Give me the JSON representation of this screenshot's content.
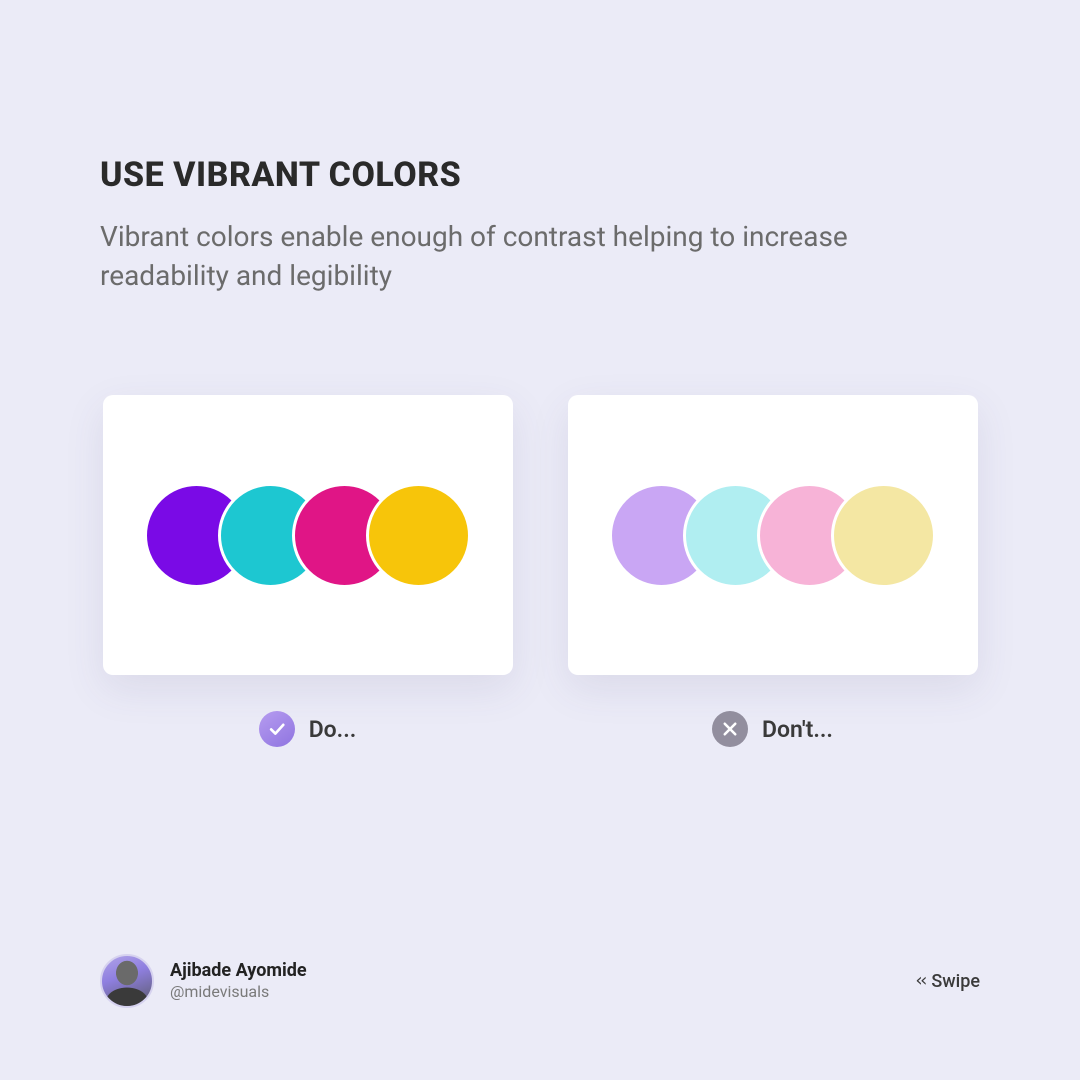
{
  "header": {
    "title": "USE VIBRANT COLORS",
    "subtitle": "Vibrant colors enable enough of contrast helping to increase readability and legibility"
  },
  "cards": {
    "do": {
      "label": "Do...",
      "badge_bg": "linear-gradient(145deg,#b69cf0,#8f74e0)",
      "swatches": [
        "#7a0ae6",
        "#1dc7d1",
        "#e01586",
        "#f7c50a"
      ]
    },
    "dont": {
      "label": "Don't...",
      "badge_bg": "#928e9e",
      "swatches": [
        "#c9a6f4",
        "#b0eef1",
        "#f7b3d7",
        "#f4e7a3"
      ]
    }
  },
  "footer": {
    "author_name": "Ajibade Ayomide",
    "author_handle": "@midevisuals",
    "swipe_label": "Swipe"
  }
}
